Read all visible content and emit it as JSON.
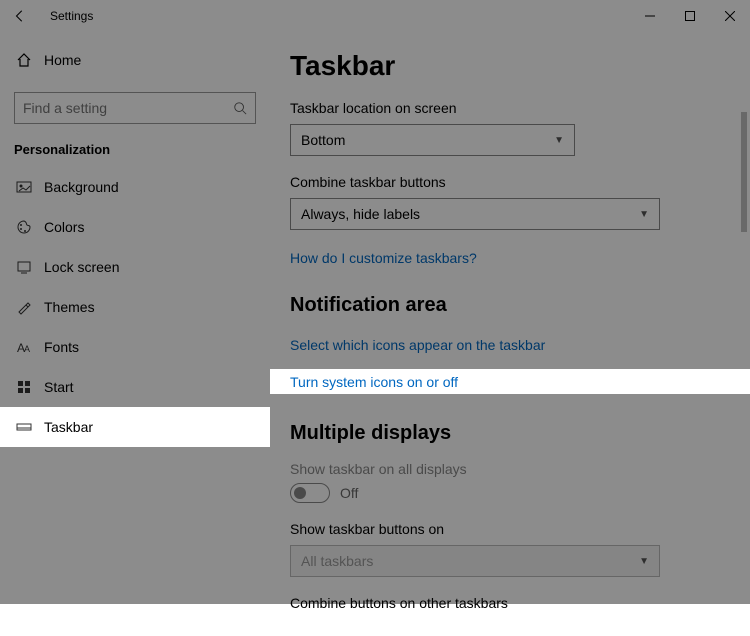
{
  "window": {
    "title": "Settings"
  },
  "sidebar": {
    "home": "Home",
    "search_placeholder": "Find a setting",
    "category": "Personalization",
    "items": [
      {
        "label": "Background"
      },
      {
        "label": "Colors"
      },
      {
        "label": "Lock screen"
      },
      {
        "label": "Themes"
      },
      {
        "label": "Fonts"
      },
      {
        "label": "Start"
      },
      {
        "label": "Taskbar"
      }
    ]
  },
  "main": {
    "title": "Taskbar",
    "location_label": "Taskbar location on screen",
    "location_value": "Bottom",
    "combine_label": "Combine taskbar buttons",
    "combine_value": "Always, hide labels",
    "customize_link": "How do I customize taskbars?",
    "notification_header": "Notification area",
    "select_icons_link": "Select which icons appear on the taskbar",
    "turn_system_icons_link": "Turn system icons on or off",
    "multiple_header": "Multiple displays",
    "show_all_label": "Show taskbar on all displays",
    "toggle_state": "Off",
    "show_buttons_label": "Show taskbar buttons on",
    "show_buttons_value": "All taskbars",
    "combine_other_label": "Combine buttons on other taskbars"
  }
}
